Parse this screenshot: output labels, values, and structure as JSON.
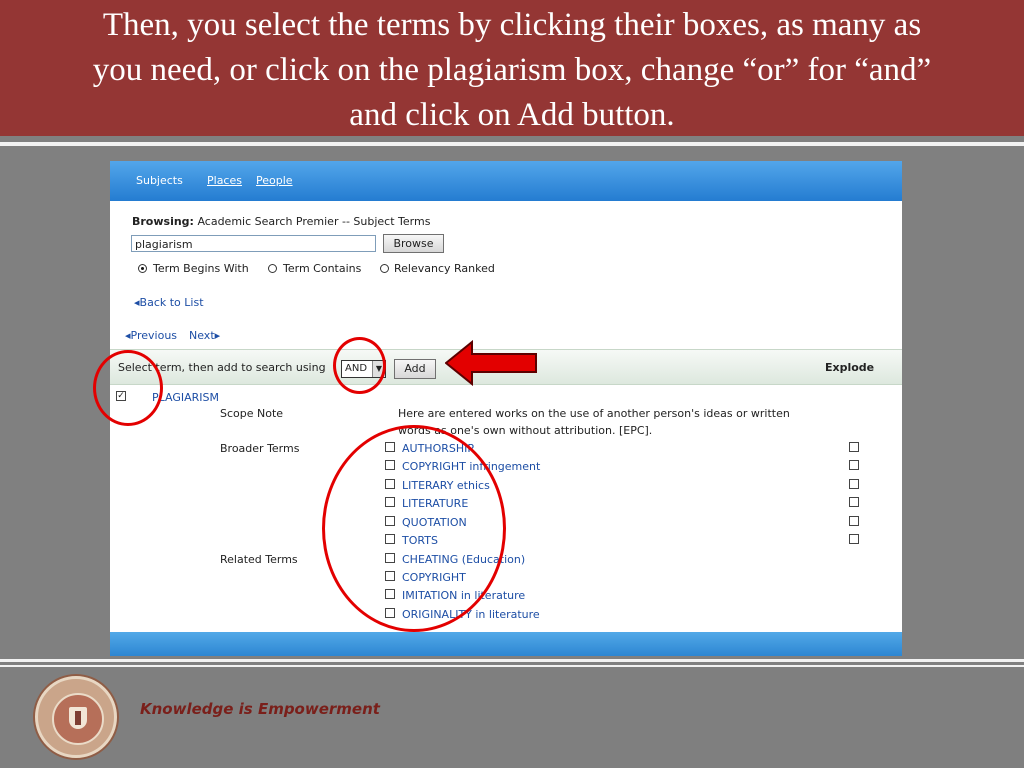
{
  "slide": {
    "title_line1": "Then, you select the terms  by clicking their boxes, as many as",
    "title_line2": "you need, or  click on the plagiarism box, change “or” for “and”",
    "title_line3": "and click on Add button.",
    "footer_tagline": "Knowledge is Empowerment"
  },
  "nav": {
    "subjects": "Subjects",
    "places": "Places",
    "people": "People"
  },
  "browse": {
    "browsing_label": "Browsing:",
    "browsing_value": "Academic Search Premier -- Subject Terms",
    "search_value": "plagiarism",
    "browse_button": "Browse",
    "options": [
      "Term Begins With",
      "Term Contains",
      "Relevancy Ranked"
    ]
  },
  "links": {
    "back_to_list": "Back to List",
    "previous": "Previous",
    "next": "Next"
  },
  "search_bar": {
    "label": "Select term, then add to search using",
    "operator": "AND",
    "add_button": "Add",
    "explode_header": "Explode"
  },
  "result": {
    "term": "PLAGIARISM",
    "scope_note_label": "Scope Note",
    "scope_note_line1": "Here are entered works on the use of another person's ideas or written",
    "scope_note_line2": "words as one's own without attribution. [EPC].",
    "broader_terms_label": "Broader Terms",
    "broader_terms": [
      "AUTHORSHIP",
      "COPYRIGHT infringement",
      "LITERARY ethics",
      "LITERATURE",
      "QUOTATION",
      "TORTS"
    ],
    "related_terms_label": "Related Terms",
    "related_terms": [
      "CHEATING (Education)",
      "COPYRIGHT",
      "IMITATION in literature",
      "ORIGINALITY in literature"
    ]
  },
  "colors": {
    "header": "#943634",
    "toolbar": "#2f87d3",
    "annotation": "#e30000"
  }
}
